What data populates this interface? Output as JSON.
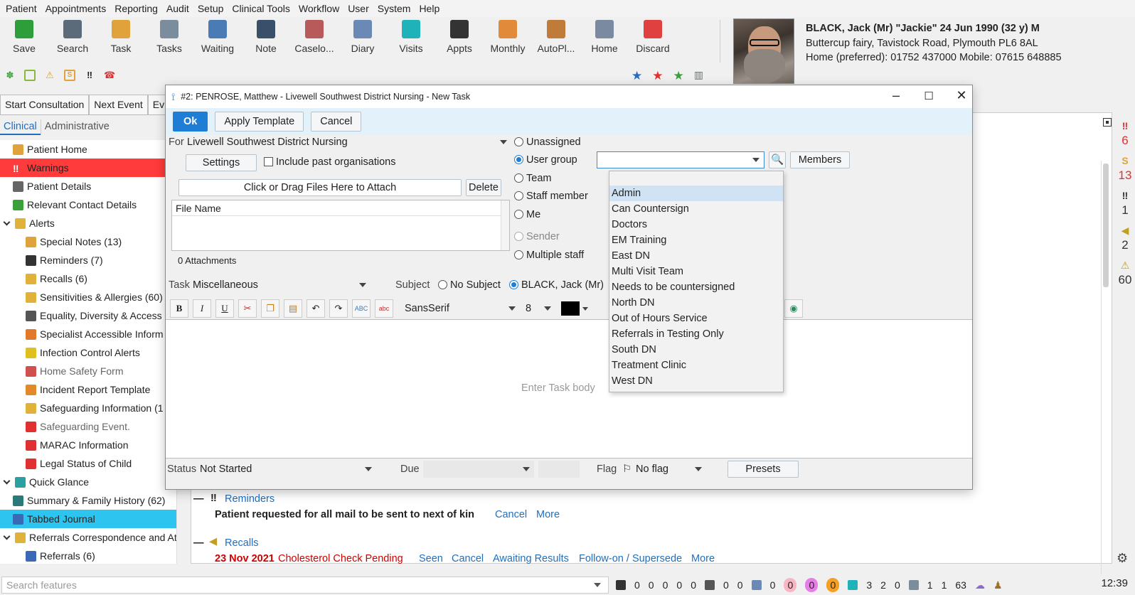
{
  "menu": [
    "Patient",
    "Appointments",
    "Reporting",
    "Audit",
    "Setup",
    "Clinical Tools",
    "Workflow",
    "User",
    "System",
    "Help"
  ],
  "toolbar": [
    {
      "label": "Save",
      "icon": "save-icon",
      "color": "#2e9e3a"
    },
    {
      "label": "Search",
      "icon": "search-icon",
      "color": "#5b6b7a"
    },
    {
      "label": "Task",
      "icon": "task-icon",
      "color": "#e0a23a"
    },
    {
      "label": "Tasks",
      "icon": "tasks-icon",
      "color": "#7b8c9c"
    },
    {
      "label": "Waiting",
      "icon": "waiting-icon",
      "color": "#4a7bb5"
    },
    {
      "label": "Note",
      "icon": "note-icon",
      "color": "#3a4f6a"
    },
    {
      "label": "Caselo...",
      "icon": "caseload-icon",
      "color": "#b85a5a"
    },
    {
      "label": "Diary",
      "icon": "diary-icon",
      "color": "#6a8ab5"
    },
    {
      "label": "Visits",
      "icon": "visits-icon",
      "color": "#1fb2b8"
    },
    {
      "label": "Appts",
      "icon": "appts-icon",
      "color": "#333333"
    },
    {
      "label": "Monthly",
      "icon": "monthly-icon",
      "color": "#e08a3a"
    },
    {
      "label": "AutoPl...",
      "icon": "autoplanner-icon",
      "color": "#c07a3a"
    },
    {
      "label": "Home",
      "icon": "home-icon",
      "color": "#7a8aa0"
    },
    {
      "label": "Discard",
      "icon": "discard-icon",
      "color": "#e04040"
    }
  ],
  "patient": {
    "name_line": "BLACK, Jack (Mr) \"Jackie\" 24 Jun 1990 (32 y) M",
    "address": "Buttercup fairy, Tavistock Road, Plymouth PL6 8AL",
    "phone": "Home (preferred): 01752 437000 Mobile: 07615 648885"
  },
  "consult_buttons": [
    "Start Consultation",
    "Next Event",
    "Ev"
  ],
  "cat_tabs": [
    "Clinical",
    "Administrative"
  ],
  "nav": [
    {
      "label": "Patient Home",
      "indent": 1,
      "icon": "home-icon",
      "color": "#e0a23a"
    },
    {
      "label": "Warnings",
      "indent": 1,
      "icon": "warning-icon",
      "color": "#ffffff",
      "warn": true
    },
    {
      "label": "Patient Details",
      "indent": 1,
      "icon": "details-icon",
      "color": "#666666"
    },
    {
      "label": "Relevant Contact Details",
      "indent": 1,
      "icon": "phone-icon",
      "color": "#3aa03a"
    },
    {
      "label": "Alerts",
      "indent": 0,
      "icon": "folder-icon",
      "color": "#e0b23a",
      "expand": true
    },
    {
      "label": "Special Notes (13)",
      "indent": 2,
      "icon": "special-notes-icon",
      "color": "#e0a23a"
    },
    {
      "label": "Reminders (7)",
      "indent": 2,
      "icon": "reminder-icon",
      "color": "#333333"
    },
    {
      "label": "Recalls (6)",
      "indent": 2,
      "icon": "recall-icon",
      "color": "#e0b23a"
    },
    {
      "label": "Sensitivities & Allergies (60)",
      "indent": 2,
      "icon": "allergy-icon",
      "color": "#e0b23a"
    },
    {
      "label": "Equality, Diversity & Access",
      "indent": 2,
      "icon": "person-icon",
      "color": "#555555"
    },
    {
      "label": "Specialist Accessible Inform",
      "indent": 2,
      "icon": "specialist-icon",
      "color": "#e07a2a"
    },
    {
      "label": "Infection Control Alerts",
      "indent": 2,
      "icon": "infection-icon",
      "color": "#e0c020"
    },
    {
      "label": "Home Safety Form",
      "indent": 2,
      "icon": "home-safety-icon",
      "color": "#d05050",
      "dim": true
    },
    {
      "label": "Incident Report Template",
      "indent": 2,
      "icon": "incident-icon",
      "color": "#e08a2a"
    },
    {
      "label": "Safeguarding Information (1",
      "indent": 2,
      "icon": "safeguarding-icon",
      "color": "#e0b23a"
    },
    {
      "label": "Safeguarding Event.",
      "indent": 2,
      "icon": "alert-red-icon",
      "color": "#e03030",
      "dim": true
    },
    {
      "label": "MARAC Information",
      "indent": 2,
      "icon": "alert-red-icon",
      "color": "#e03030"
    },
    {
      "label": "Legal Status of Child",
      "indent": 2,
      "icon": "alert-red-icon",
      "color": "#e03030"
    },
    {
      "label": "Quick Glance",
      "indent": 0,
      "icon": "eye-icon",
      "color": "#2aa0a0",
      "expand": true
    },
    {
      "label": "Summary & Family History (62)",
      "indent": 1,
      "icon": "summary-icon",
      "color": "#2a7a7a"
    },
    {
      "label": "Tabbed Journal",
      "indent": 1,
      "icon": "journal-icon",
      "color": "#3a6ab5",
      "selected": true
    },
    {
      "label": "Referrals Correspondence and Att",
      "indent": 0,
      "icon": "folder-icon",
      "color": "#e0b23a",
      "expand": true
    },
    {
      "label": "Referrals (6)",
      "indent": 2,
      "icon": "arrow-icon",
      "color": "#3a6ab5"
    }
  ],
  "dialog": {
    "title": "#2: PENROSE, Matthew - Livewell Southwest District Nursing - New Task",
    "ok": "Ok",
    "apply_template": "Apply Template",
    "cancel": "Cancel",
    "for_label": "For",
    "for_value": "Livewell Southwest District Nursing",
    "settings": "Settings",
    "include_past": "Include past organisations",
    "attach": "Click or Drag Files Here to Attach",
    "delete": "Delete",
    "file_name_col": "File Name",
    "attachments_count": "0 Attachments",
    "assign_options": [
      "Unassigned",
      "User group",
      "Team",
      "Staff member",
      "Me",
      "Sender",
      "Multiple staff"
    ],
    "assign_selected": "User group",
    "members": "Members",
    "task_label": "Task",
    "task_value": "Miscellaneous",
    "subject_label": "Subject",
    "subject_opt1": "No Subject",
    "subject_opt2": "BLACK, Jack (Mr)",
    "font_name": "SansSerif",
    "font_size": "8",
    "body_placeholder": "Enter Task body",
    "status_label": "Status",
    "status_value": "Not Started",
    "due_label": "Due",
    "flag_label": "Flag",
    "flag_value": "No flag",
    "presets": "Presets"
  },
  "user_groups": [
    "Admin",
    "Can Countersign",
    "Doctors",
    "EM Training",
    "East DN",
    "Multi Visit Team",
    "Needs to be countersigned",
    "North DN",
    "Out of Hours Service",
    "Referrals in Testing Only",
    "South DN",
    "Treatment Clinic",
    "West DN"
  ],
  "user_group_highlighted": "Admin",
  "journal": {
    "reminders_heading": "Reminders",
    "reminder_text": "Patient requested for all mail to be sent to next of kin",
    "reminder_actions": [
      "Cancel",
      "More"
    ],
    "recalls_heading": "Recalls",
    "recall_date": "23 Nov 2021",
    "recall_text": "Cholesterol Check Pending",
    "recall_actions": [
      "Seen",
      "Cancel",
      "Awaiting Results",
      "Follow-on / Supersede",
      "More"
    ]
  },
  "counters": [
    {
      "icon": "reminder-icon",
      "value": "6",
      "color": "#e03030"
    },
    {
      "icon": "special-notes-icon",
      "value": "13",
      "color": "#e03030"
    },
    {
      "icon": "reminder-icon",
      "value": "1",
      "color": "#333333"
    },
    {
      "icon": "recall-icon",
      "value": "2",
      "color": "#333333"
    },
    {
      "icon": "allergy-icon",
      "value": "60",
      "color": "#333333"
    }
  ],
  "statusbar": {
    "search_placeholder": "Search features",
    "group1": [
      "0",
      "0",
      "0",
      "0",
      "0"
    ],
    "group2": [
      "0",
      "0"
    ],
    "group3": [
      "0"
    ],
    "pills": [
      {
        "value": "0",
        "color": "#f7b6c2"
      },
      {
        "value": "0",
        "color": "#e57ee5"
      },
      {
        "value": "0",
        "color": "#f5a020"
      }
    ],
    "group4": [
      "3",
      "2",
      "0"
    ],
    "group5": [
      "1",
      "1",
      "63"
    ],
    "time": "12:39"
  },
  "colors": {
    "accent": "#1e7dd4",
    "selected_nav": "#2ec4f0",
    "warning_nav": "#ff3b3b",
    "link": "#1f6fbf",
    "recall_red": "#d00000"
  }
}
